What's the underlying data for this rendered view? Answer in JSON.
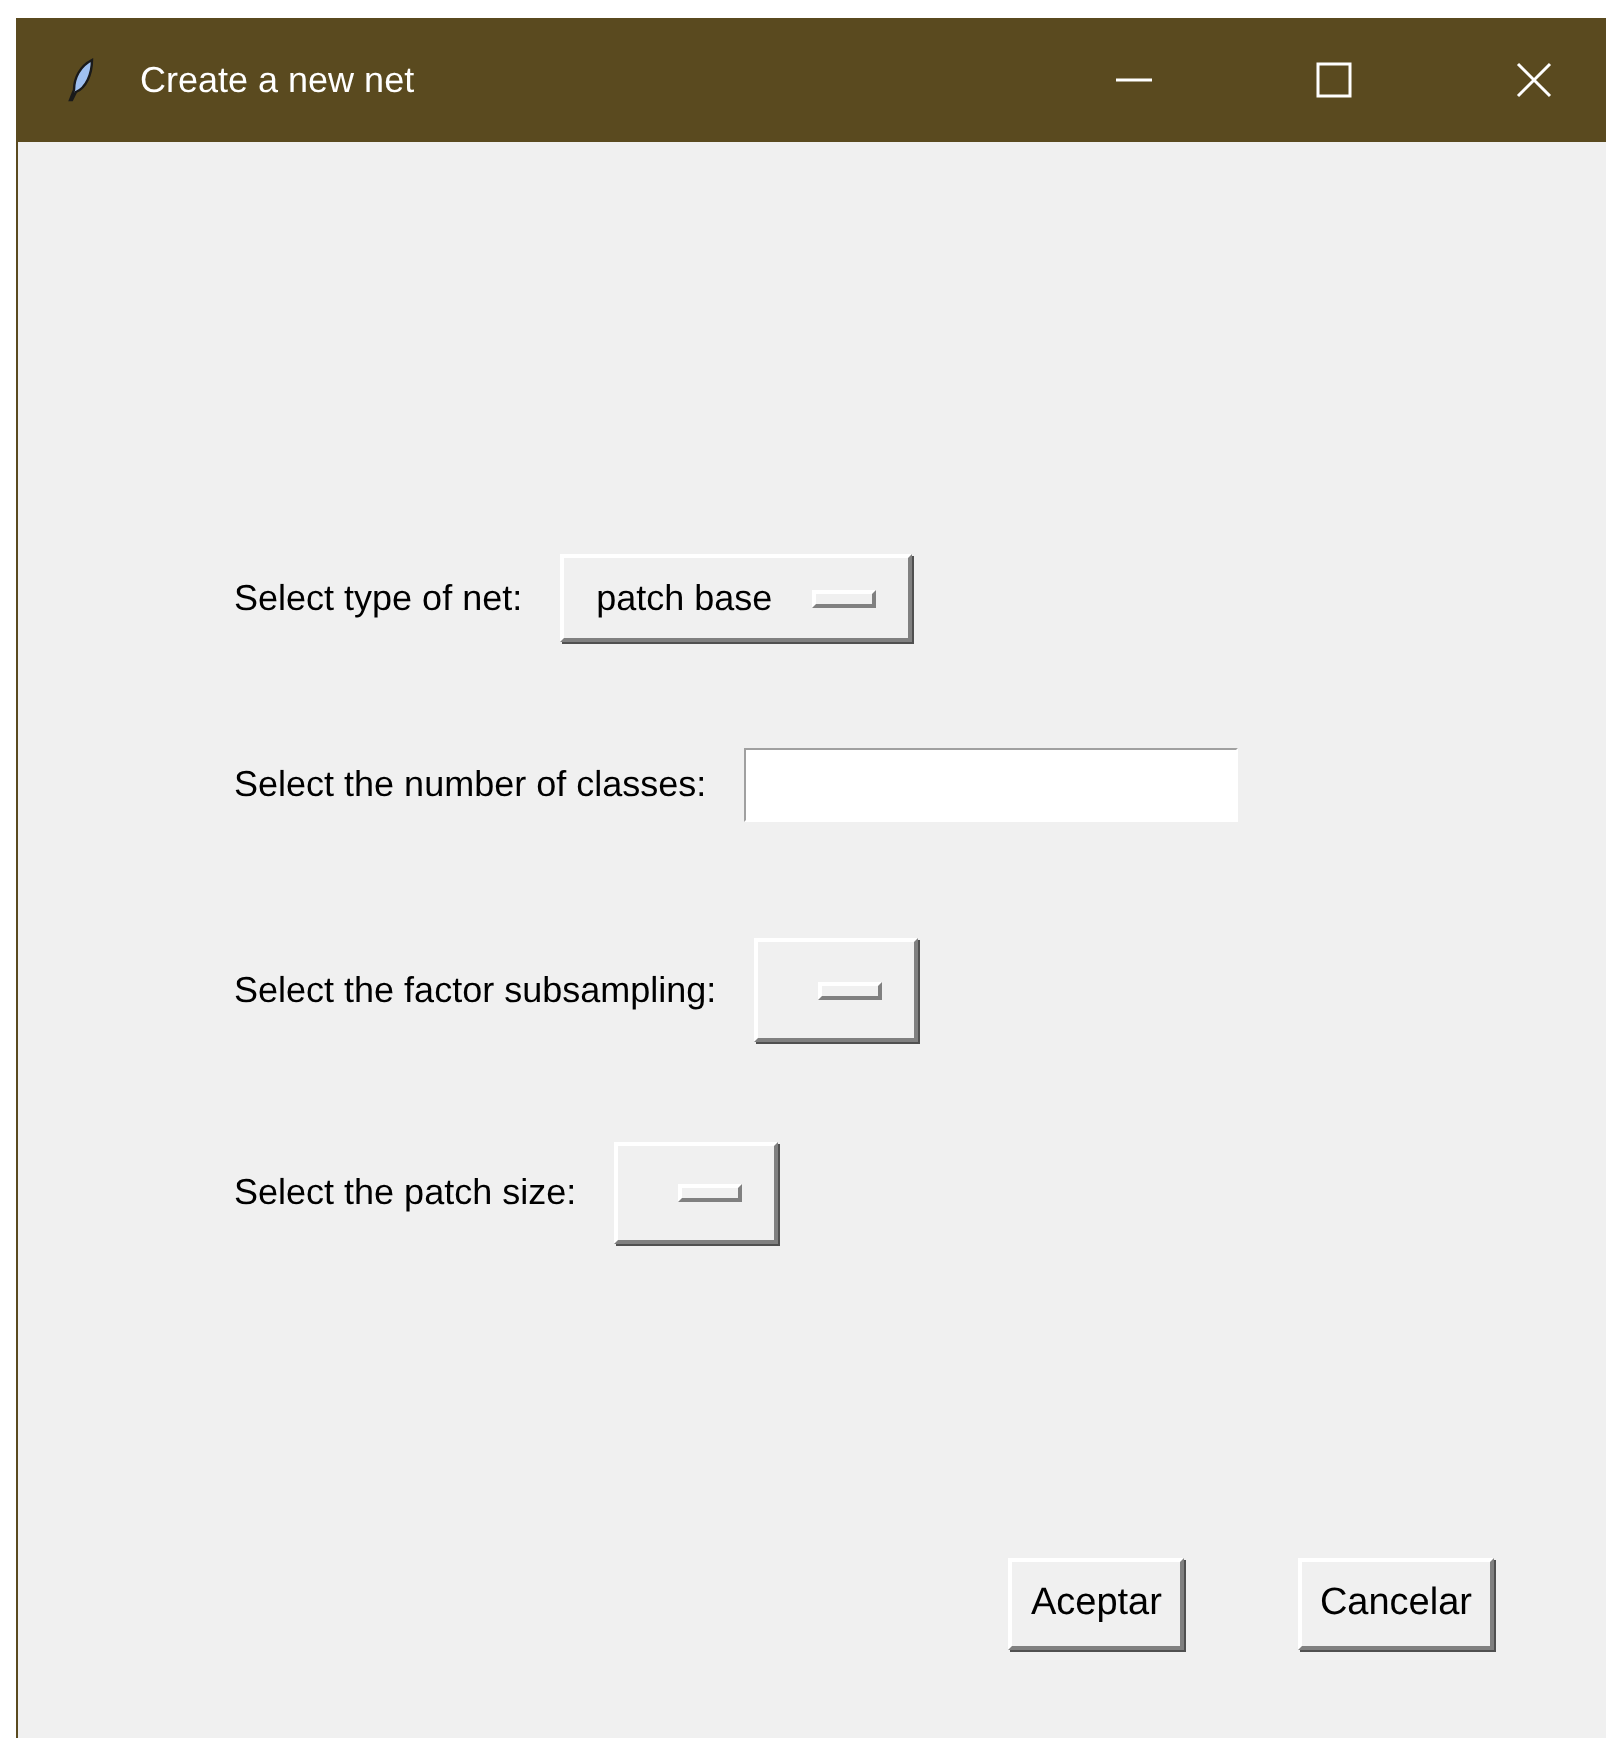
{
  "window": {
    "title": "Create a new net"
  },
  "fields": [
    {
      "kind": "option_menu",
      "label": "Select type of net:",
      "value": "patch base"
    },
    {
      "kind": "entry",
      "label": "Select the number of classes:"
    },
    {
      "kind": "option_menu",
      "label": "Select the factor subsampling:"
    },
    {
      "kind": "option_menu",
      "label": "Select the patch size:"
    }
  ],
  "buttons": [
    "Aceptar",
    "Cancelar"
  ]
}
